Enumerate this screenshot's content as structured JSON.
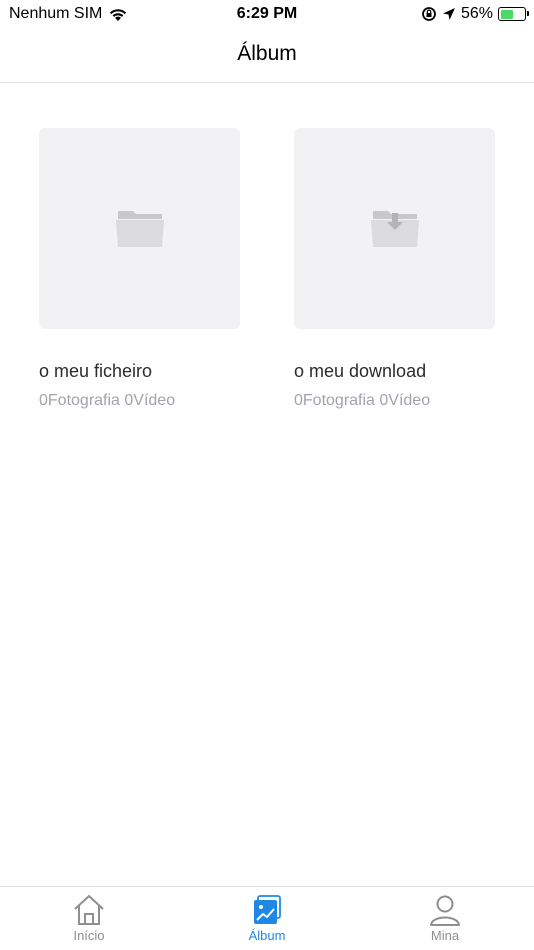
{
  "status_bar": {
    "carrier": "Nenhum SIM",
    "time": "6:29 PM",
    "battery_percent": "56%",
    "battery_level": 0.56
  },
  "nav": {
    "title": "Álbum"
  },
  "albums": [
    {
      "name": "o meu ficheiro",
      "count": "0Fotografia 0Vídeo",
      "icon": "folder-icon"
    },
    {
      "name": "o meu download",
      "count": "0Fotografia 0Vídeo",
      "icon": "download-folder-icon"
    }
  ],
  "tabs": [
    {
      "label": "Início",
      "icon": "home-icon",
      "active": false
    },
    {
      "label": "Álbum",
      "icon": "album-icon",
      "active": true
    },
    {
      "label": "Mina",
      "icon": "person-icon",
      "active": false
    }
  ],
  "colors": {
    "accent": "#1f88e5",
    "inactive": "#8e8e93",
    "thumb_bg": "#f2f2f4"
  }
}
